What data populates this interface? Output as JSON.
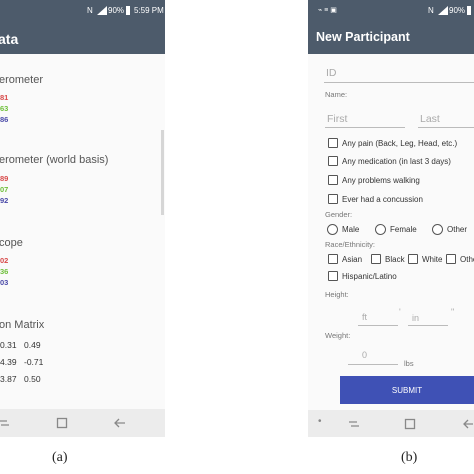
{
  "panel_a": {
    "status": {
      "icons": [
        "nfc-icon",
        "signal-icon",
        "battery-icon"
      ],
      "battery": "90%",
      "time": "5:59 PM"
    },
    "title": "ata",
    "sections": [
      {
        "title": "erometer",
        "values": [
          {
            "text": "81",
            "color": "#d84a4a"
          },
          {
            "text": "63",
            "color": "#6fbf3a"
          },
          {
            "text": "86",
            "color": "#4a4aa8"
          }
        ]
      },
      {
        "title": "erometer (world basis)",
        "values": [
          {
            "text": "89",
            "color": "#d84a4a"
          },
          {
            "text": "07",
            "color": "#6fbf3a"
          },
          {
            "text": "92",
            "color": "#4a4aa8"
          }
        ]
      },
      {
        "title": "cope",
        "values": [
          {
            "text": "02",
            "color": "#d84a4a"
          },
          {
            "text": "36",
            "color": "#6fbf3a"
          },
          {
            "text": "03",
            "color": "#4a4aa8"
          }
        ]
      }
    ],
    "matrix": {
      "title": "on Matrix",
      "rows": [
        [
          "0.31",
          "0.49"
        ],
        [
          "4.39",
          "-0.71"
        ],
        [
          "3.87",
          "0.50"
        ]
      ]
    },
    "caption": "(a)"
  },
  "panel_b": {
    "status": {
      "icons": [
        "notification-icons",
        "nfc-icon",
        "signal-icon",
        "battery-icon"
      ],
      "battery": "90%"
    },
    "title": "New Participant",
    "id_placeholder": "ID",
    "name_label": "Name:",
    "first_placeholder": "First",
    "last_placeholder": "Last",
    "checkboxes": [
      "Any pain (Back, Leg, Head, etc.)",
      "Any medication (in last 3 days)",
      "Any problems walking",
      "Ever had a concussion"
    ],
    "gender_label": "Gender:",
    "gender_options": [
      "Male",
      "Female",
      "Other"
    ],
    "race_label": "Race/Ethnicity:",
    "race_options": [
      "Asian",
      "Black",
      "White",
      "Othe"
    ],
    "hispanic_label": "Hispanic/Latino",
    "height_label": "Height:",
    "ft_placeholder": "ft",
    "in_placeholder": "in",
    "weight_label": "Weight:",
    "weight_value": "0",
    "weight_unit": "lbs",
    "submit_label": "SUBMIT",
    "caption": "(b)"
  },
  "colors": {
    "appbar": "#4d5b6b",
    "submit": "#3f51b5"
  }
}
